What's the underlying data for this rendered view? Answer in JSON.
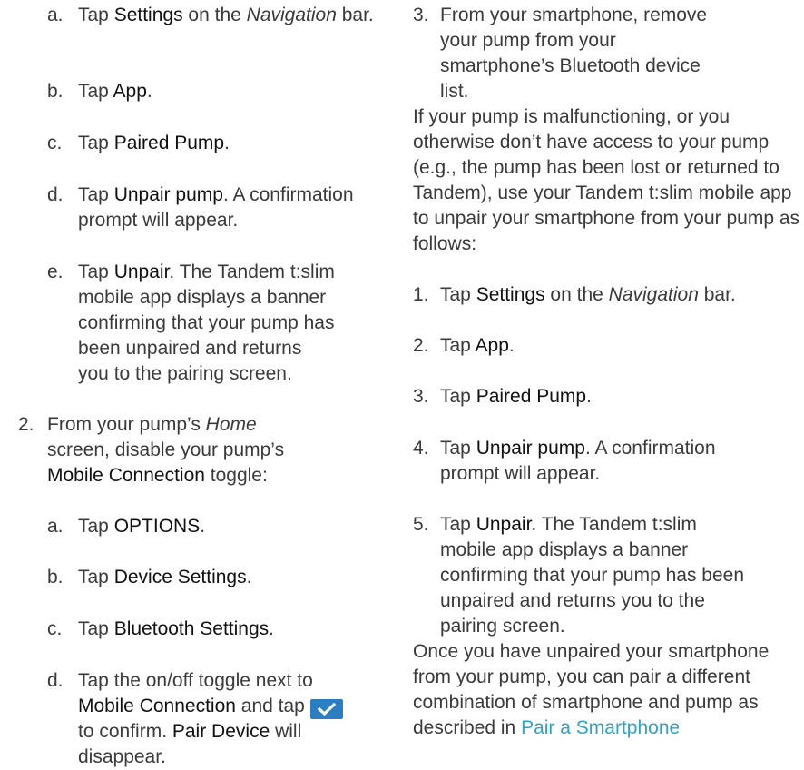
{
  "left": {
    "sub_a1": {
      "marker": "a.",
      "t1": "Tap ",
      "b1": "Settings",
      "t2": " on the ",
      "i1": "Navigation",
      "t3": " bar."
    },
    "sub_b1": {
      "marker": "b.",
      "t1": "Tap ",
      "b1": "App",
      "t2": "."
    },
    "sub_c1": {
      "marker": "c.",
      "t1": "Tap ",
      "b1": "Paired Pump",
      "t2": "."
    },
    "sub_d1": {
      "marker": "d.",
      "t1": "Tap ",
      "b1": "Unpair pump",
      "t2": ". A confirmation prompt will appear."
    },
    "sub_e1": {
      "marker": "e.",
      "t1": "Tap ",
      "b1": "Unpair",
      "t2": ". The Tandem t:slim mobile app displays a banner confirming that your pump has been unpaired and returns you to the pairing screen."
    },
    "step2": {
      "marker": "2.",
      "t1": "From your pump’s ",
      "i1": "Home",
      "t2": " screen, disable your pump’s ",
      "b1": "Mobile Connection",
      "t3": " toggle:"
    },
    "sub_a2": {
      "marker": "a.",
      "t1": "Tap ",
      "b1": "OPTIONS",
      "t2": "."
    },
    "sub_b2": {
      "marker": "b.",
      "t1": "Tap ",
      "b1": "Device Settings",
      "t2": "."
    },
    "sub_c2": {
      "marker": "c.",
      "t1": "Tap ",
      "b1": "Bluetooth Settings",
      "t2": "."
    },
    "sub_d2": {
      "marker": "d.",
      "t1": "Tap the on/off toggle next to ",
      "b1": "Mobile Connection",
      "t2": " and tap ",
      "icon": "checkmark-icon",
      "t3": " to confirm. ",
      "b2": "Pair Device",
      "t4": " will disappear."
    }
  },
  "right": {
    "step3": {
      "marker": "3.",
      "text": "From your smartphone, remove your pump from your smartphone’s Bluetooth device list."
    },
    "para1": "If your pump is malfunctioning, or you otherwise don’t have access to your pump (e.g., the pump has been lost or returned to Tandem), use your Tandem t:slim mobile app to unpair your smartphone from your pump as follows:",
    "r1": {
      "marker": "1.",
      "t1": "Tap ",
      "b1": "Settings",
      "t2": " on the ",
      "i1": "Navigation",
      "t3": " bar."
    },
    "r2": {
      "marker": "2.",
      "t1": "Tap ",
      "b1": "App",
      "t2": "."
    },
    "r3": {
      "marker": "3.",
      "t1": "Tap ",
      "b1": "Paired Pump",
      "t2": "."
    },
    "r4": {
      "marker": "4.",
      "t1": "Tap ",
      "b1": "Unpair pump",
      "t2": ". A confirmation prompt will appear."
    },
    "r5": {
      "marker": "5.",
      "t1": "Tap ",
      "b1": "Unpair",
      "t2": ". The Tandem t:slim mobile app displays a banner confirming that your pump has been unpaired and returns you to the pairing screen."
    },
    "para2": "Once you have unpaired your smartphone from your pump, you can pair a different combination of smartphone and pump as described in",
    "link": "Pair a Smartphone"
  },
  "colors": {
    "text": "#3a3a3a",
    "emphasis": "#111111",
    "link": "#2da3c9",
    "icon_bg": "#2a7ec1"
  }
}
